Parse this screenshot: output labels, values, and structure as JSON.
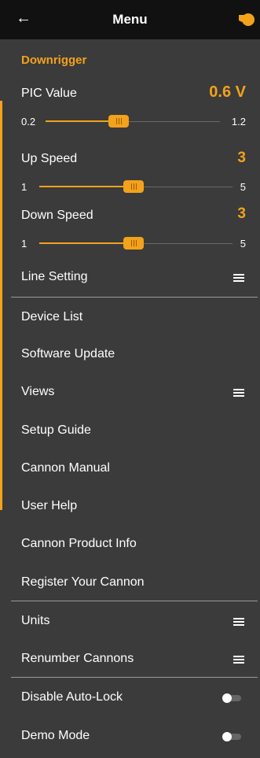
{
  "header": {
    "title": "Menu",
    "back_icon": "arrow-left-icon",
    "logo": "cannon-logo"
  },
  "section": {
    "title": "Downrigger"
  },
  "pic_value": {
    "label": "PIC Value",
    "value": "0.6 V",
    "min": "0.2",
    "max": "1.2",
    "level": 0.4
  },
  "up_speed": {
    "label": "Up Speed",
    "value": "3",
    "min": "1",
    "max": "5",
    "level": 0.5
  },
  "down_speed": {
    "label": "Down Speed",
    "value": "3",
    "min": "1",
    "max": "5",
    "level": 0.5
  },
  "menu": {
    "line_setting": "Line Setting",
    "device_list": "Device List",
    "software_update": "Software Update",
    "views": "Views",
    "setup_guide": "Setup Guide",
    "cannon_manual": "Cannon Manual",
    "user_help": "User Help",
    "cannon_product_info": "Cannon Product Info",
    "register_your_cannon": "Register Your Cannon",
    "units": "Units",
    "renumber_cannons": "Renumber Cannons",
    "disable_auto_lock": "Disable Auto-Lock",
    "demo_mode": "Demo Mode"
  },
  "toggles": {
    "disable_auto_lock": false,
    "demo_mode": false
  },
  "colors": {
    "accent": "#f3a21b",
    "header_bg": "#111111",
    "panel_bg": "#3b3b3b"
  }
}
